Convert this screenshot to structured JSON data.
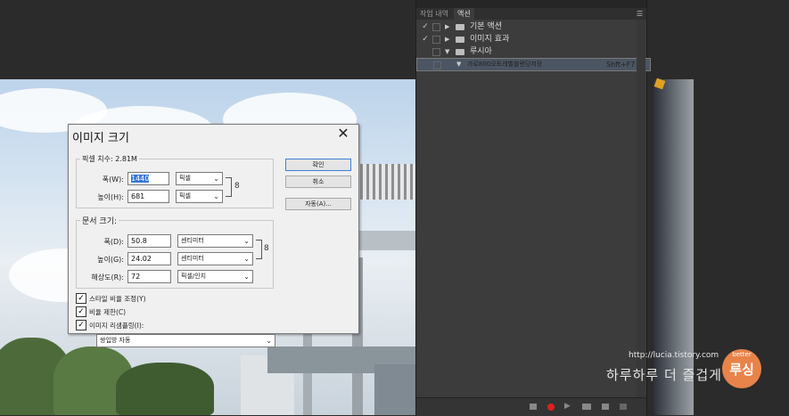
{
  "panel": {
    "tabs": [
      {
        "label": "작업 내역"
      },
      {
        "label": "액션"
      }
    ],
    "actions": [
      {
        "label": "기본 액션",
        "checked": "✓"
      },
      {
        "label": "이미지 효과",
        "checked": "✓"
      },
      {
        "label": "루시아",
        "checked": ""
      },
      {
        "label": "가로800오토레벨블렌딩저장",
        "shortcut": "Shft+F7"
      }
    ]
  },
  "dialog": {
    "title": "이미지 크기",
    "pixel_group": "픽셀 치수: 2.81M",
    "width_label": "폭(W):",
    "width_value": "1440",
    "width_unit": "픽셀",
    "height_label": "높이(H):",
    "height_value": "681",
    "height_unit": "픽셀",
    "doc_group": "문서 크기:",
    "doc_width_label": "폭(D):",
    "doc_width_value": "50.8",
    "doc_width_unit": "센티미터",
    "doc_height_label": "높이(G):",
    "doc_height_value": "24.02",
    "doc_height_unit": "센티미터",
    "res_label": "해상도(R):",
    "res_value": "72",
    "res_unit": "픽셀/인치",
    "ok_button": "확인",
    "cancel_button": "취소",
    "auto_button": "자동(A)...",
    "scale_styles": "스타일 비율 조정(Y)",
    "constrain": "비율 제한(C)",
    "resample": "이미지 리샘플링(I):",
    "resample_method": "쌍입방 자동"
  },
  "watermark": {
    "url": "http://lucia.tistory.com",
    "text": "하루하루 더 즐겁게",
    "logo_small": "better",
    "logo": "루싱"
  },
  "colors": {
    "panel_bg": "#3c3c3c",
    "selected_row": "#4b5563",
    "record_red": "#e02020",
    "logo_orange": "#e8834a"
  }
}
